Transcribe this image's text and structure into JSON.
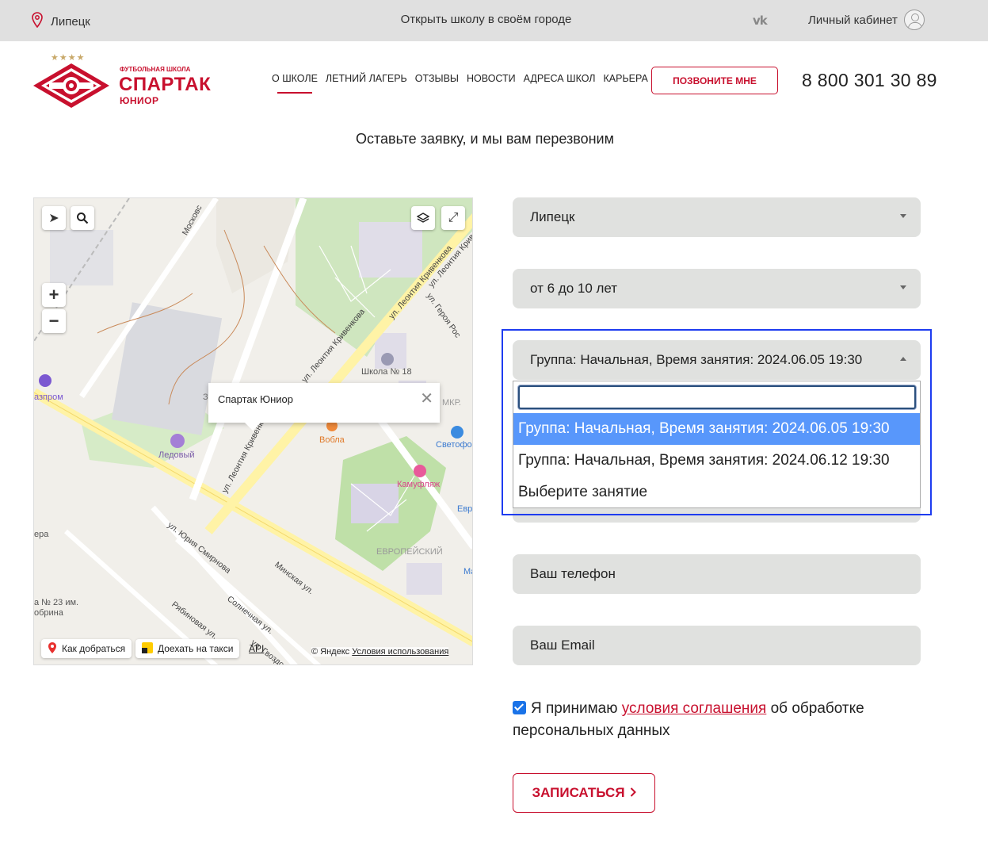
{
  "topbar": {
    "city": "Липецк",
    "open_school": "Открыть школу в своём городе",
    "vk_label": "vk",
    "cabinet": "Личный кабинет"
  },
  "brand": {
    "small": "ФУТБОЛЬНАЯ ШКОЛА",
    "big": "СПАРТАК",
    "junior": "ЮНИОР",
    "color": "#c8102e"
  },
  "nav": [
    "О ШКОЛЕ",
    "ЛЕТНИЙ ЛАГЕРЬ",
    "ОТЗЫВЫ",
    "НОВОСТИ",
    "АДРЕСА ШКОЛ",
    "КАРЬЕРА"
  ],
  "header": {
    "call_button": "ПОЗВОНИТЕ МНЕ",
    "phone": "8 800 301 30 89"
  },
  "form": {
    "title": "Оставьте заявку, и мы вам перезвоним",
    "city_select": "Липецк",
    "age_select": "от 6 до 10 лет",
    "group_select": "Группа: Начальная, Время занятия: 2024.06.05 19:30",
    "dropdown_search": "",
    "options": [
      "Группа: Начальная, Время занятия: 2024.06.05 19:30",
      "Группа: Начальная, Время занятия: 2024.06.12 19:30",
      "Выберите занятие"
    ],
    "phone_placeholder": "Ваш телефон",
    "email_placeholder": "Ваш Email",
    "consent_before": "Я принимаю ",
    "consent_link": "условия соглашения",
    "consent_after": " об обработке персональных данных",
    "consent_checked": true,
    "submit": "ЗАПИСАТЬСЯ"
  },
  "map": {
    "popup": "Спартак Юниор",
    "route": "Как добраться",
    "taxi": "Доехать на такси",
    "api": "API",
    "copyright_prefix": "© Яндекс ",
    "copyright_link": "Условия использования",
    "labels": {
      "school18": "Школа № 18",
      "gazprom": "азпром",
      "ledovy": "Ледовый",
      "vobla": "Вобла",
      "svetofor": "Светофо",
      "kamuflyazh": "Камуфляж",
      "evropeisky": "ЕВРОПЕЙСКИЙ",
      "mkr": "МКР.",
      "evr": "Евр",
      "ma": "Ма",
      "zz": "З",
      "era": "ера",
      "school23a": "а № 23 им.",
      "school23b": "обрина"
    },
    "streets": {
      "moskovskaya": "Московс",
      "krivenkova1": "ул. Леонтия Кривенкова",
      "krivenkova2": "ул. Леонтия Кривенкова",
      "krivenkova3": "ул. Леонтия Кривенкова",
      "krivenkova4": "ул. Леонтия Кривенков",
      "geroya": "ул. Героя Рос",
      "smirnova": "ул. Юрия Смирнова",
      "minskaya": "Минская ул.",
      "solnechnaya": "Солнечная ул.",
      "ryabinovaya": "Рябиновая ул.",
      "gvozdovaya": "ул. Гвоздовая"
    }
  }
}
